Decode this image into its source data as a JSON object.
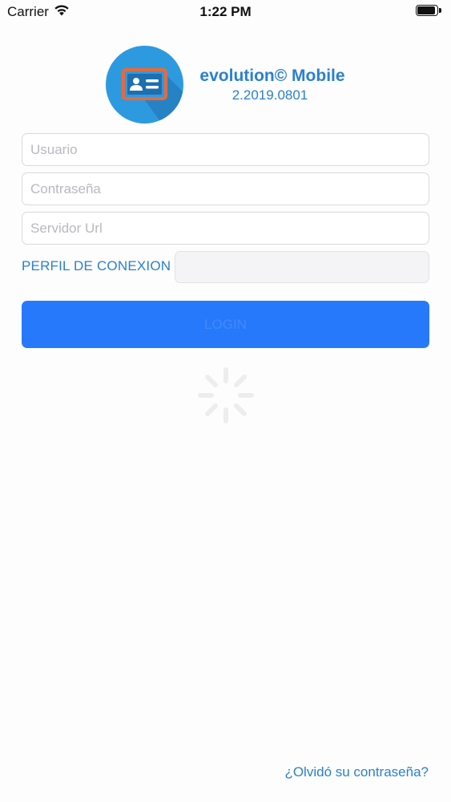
{
  "status_bar": {
    "carrier": "Carrier",
    "time": "1:22 PM",
    "wifi_icon": "wifi-icon",
    "battery_icon": "battery-icon"
  },
  "header": {
    "logo_icon": "id-card-icon",
    "title": "evolution© Mobile",
    "version": "2.2019.0801"
  },
  "form": {
    "username": {
      "value": "",
      "placeholder": "Usuario"
    },
    "password": {
      "value": "",
      "placeholder": "Contraseña"
    },
    "server_url": {
      "value": "",
      "placeholder": "Servidor Url"
    },
    "profile_label": "PERFIL DE CONEXION",
    "profile_value": "",
    "login_label": "LOGIN"
  },
  "footer": {
    "forgot_password": "¿Olvidó su contraseña?"
  },
  "colors": {
    "accent_text": "#2b80cf",
    "button": "#2779fb",
    "logo_bg": "#2d9ae0",
    "logo_card_border": "#e8693a"
  }
}
